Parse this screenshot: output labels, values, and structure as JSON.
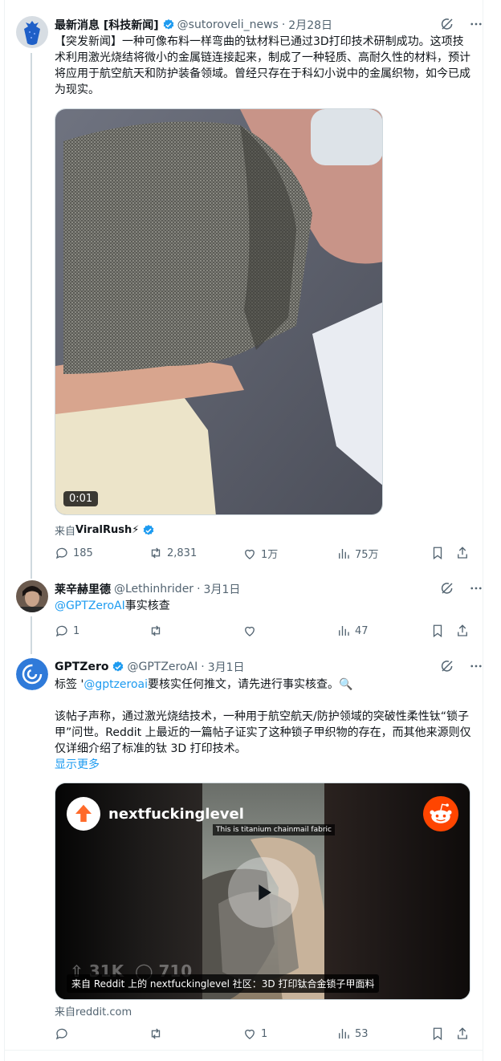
{
  "tweets": [
    {
      "name": "最新消息 [科技新闻]",
      "handle": "@sutoroveli_news",
      "sep": "·",
      "date": "2月28日",
      "text": "【突发新闻】一种可像布料一样弯曲的钛材料已通过3D打印技术研制成功。这项技术利用激光烧结将微小的金属链连接起来，制成了一种轻质、高耐久性的材料，预计将应用于航空航天和防护装备领域。曾经只存在于科幻小说中的金属织物，如今已成为现实。",
      "video_duration": "0:01",
      "source_prefix": "来自",
      "source_name": "ViralRush⚡",
      "replies": "185",
      "retweets": "2,831",
      "likes": "1万",
      "views": "75万"
    },
    {
      "name": "莱辛赫里德",
      "handle": "@Lethinhrider",
      "sep": "·",
      "date": "3月1日",
      "mention": "@GPTZeroAI",
      "text_rest": "事实核查",
      "replies": "1",
      "retweets": "",
      "likes": "",
      "views": "47"
    },
    {
      "name": "GPTZero",
      "handle": "@GPTZeroAI",
      "sep": "·",
      "date": "3月1日",
      "text_pre": "标签 '",
      "mention": "@gptzeroai",
      "text_post": "要核实任何推文，请先进行事实核查。🔍",
      "body": "该帖子声称，通过激光烧结技术，一种用于航空航天/防护领域的突破性柔性钛“锁子甲”问世。Reddit 上最近的一篇帖子证实了这种锁子甲织物的存在，而其他来源则仅仅详细介绍了标准的钛 3D 打印技术。",
      "show_more": "显示更多",
      "media_subreddit": "nextfuckinglevel",
      "media_overlay_text": "This is titanium chainmail fabric",
      "media_stats_up": "31K",
      "media_stats_comments": "710",
      "media_caption": "来自 Reddit 上的 nextfuckinglevel 社区：3D 打印钛合金锁子甲面料",
      "source": "来自reddit.com",
      "replies": "",
      "retweets": "",
      "likes": "1",
      "views": "53"
    }
  ],
  "colors": {
    "accent": "#1d9bf0",
    "text": "#0f1419",
    "secondary": "#536471",
    "reddit_orange": "#ff4500"
  }
}
